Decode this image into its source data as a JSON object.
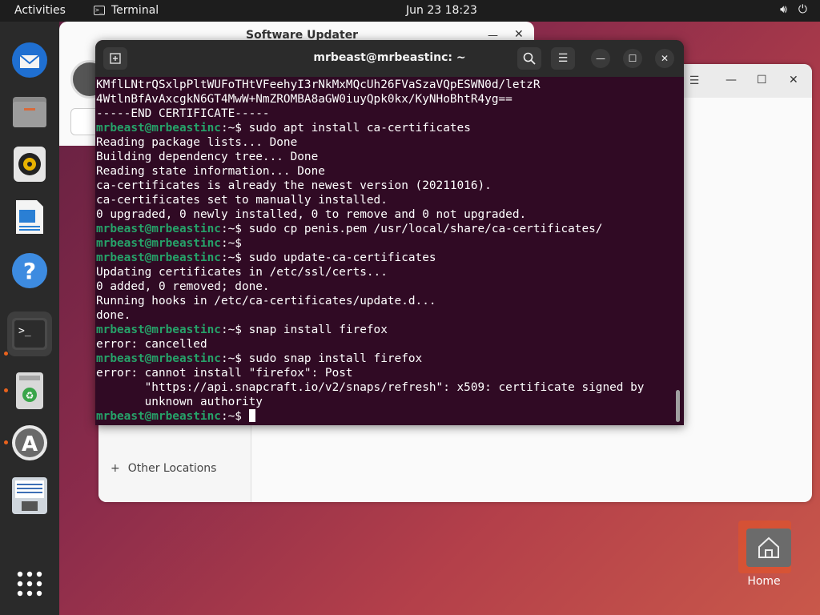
{
  "topbar": {
    "activities": "Activities",
    "app_name": "Terminal",
    "clock": "Jun 23  18:23",
    "volume_icon": "volume-icon",
    "power_icon": "power-icon"
  },
  "dock": {
    "items": [
      {
        "name": "thunderbird",
        "icon": "mail-icon"
      },
      {
        "name": "files",
        "icon": "folder-icon"
      },
      {
        "name": "rhythmbox",
        "icon": "speaker-icon"
      },
      {
        "name": "libreoffice-writer",
        "icon": "document-icon"
      },
      {
        "name": "help",
        "icon": "help-icon"
      },
      {
        "name": "terminal",
        "icon": "terminal-icon"
      },
      {
        "name": "trash",
        "icon": "trash-icon"
      },
      {
        "name": "software",
        "icon": "software-icon"
      },
      {
        "name": "installer",
        "icon": "drive-icon"
      },
      {
        "name": "show-apps",
        "icon": "grid-icon"
      }
    ]
  },
  "software_updater": {
    "title": "Software Updater"
  },
  "files_window": {
    "other_locations": "Other Locations"
  },
  "terminal": {
    "title": "mrbeast@mrbeastinc: ~",
    "prompt": "mrbeast@mrbeastinc",
    "lines": [
      {
        "type": "out",
        "text": "KMflLNtrQSxlpPltWUFoTHtVFeehyI3rNkMxMQcUh26FVaSzaVQpESWN0d/letzR"
      },
      {
        "type": "out",
        "text": "4WtlnBfAvAxcgkN6GT4MwW+NmZROMBA8aGW0iuyQpk0kx/KyNHoBhtR4yg=="
      },
      {
        "type": "out",
        "text": "-----END CERTIFICATE-----"
      },
      {
        "type": "cmd",
        "text": "sudo apt install ca-certificates"
      },
      {
        "type": "out",
        "text": "Reading package lists... Done"
      },
      {
        "type": "out",
        "text": "Building dependency tree... Done"
      },
      {
        "type": "out",
        "text": "Reading state information... Done"
      },
      {
        "type": "out",
        "text": "ca-certificates is already the newest version (20211016)."
      },
      {
        "type": "out",
        "text": "ca-certificates set to manually installed."
      },
      {
        "type": "out",
        "text": "0 upgraded, 0 newly installed, 0 to remove and 0 not upgraded."
      },
      {
        "type": "cmd",
        "text": "sudo cp penis.pem /usr/local/share/ca-certificates/"
      },
      {
        "type": "cmd",
        "text": ""
      },
      {
        "type": "cmd",
        "text": "sudo update-ca-certificates"
      },
      {
        "type": "out",
        "text": "Updating certificates in /etc/ssl/certs..."
      },
      {
        "type": "out",
        "text": "0 added, 0 removed; done."
      },
      {
        "type": "out",
        "text": "Running hooks in /etc/ca-certificates/update.d..."
      },
      {
        "type": "out",
        "text": "done."
      },
      {
        "type": "cmd",
        "text": "snap install firefox"
      },
      {
        "type": "out",
        "text": "error: cancelled"
      },
      {
        "type": "cmd",
        "text": "sudo snap install firefox"
      },
      {
        "type": "out",
        "text": "error: cannot install \"firefox\": Post"
      },
      {
        "type": "out",
        "text": "       \"https://api.snapcraft.io/v2/snaps/refresh\": x509: certificate signed by"
      },
      {
        "type": "out",
        "text": "       unknown authority"
      },
      {
        "type": "cur",
        "text": ""
      }
    ]
  },
  "desktop": {
    "home_label": "Home"
  }
}
